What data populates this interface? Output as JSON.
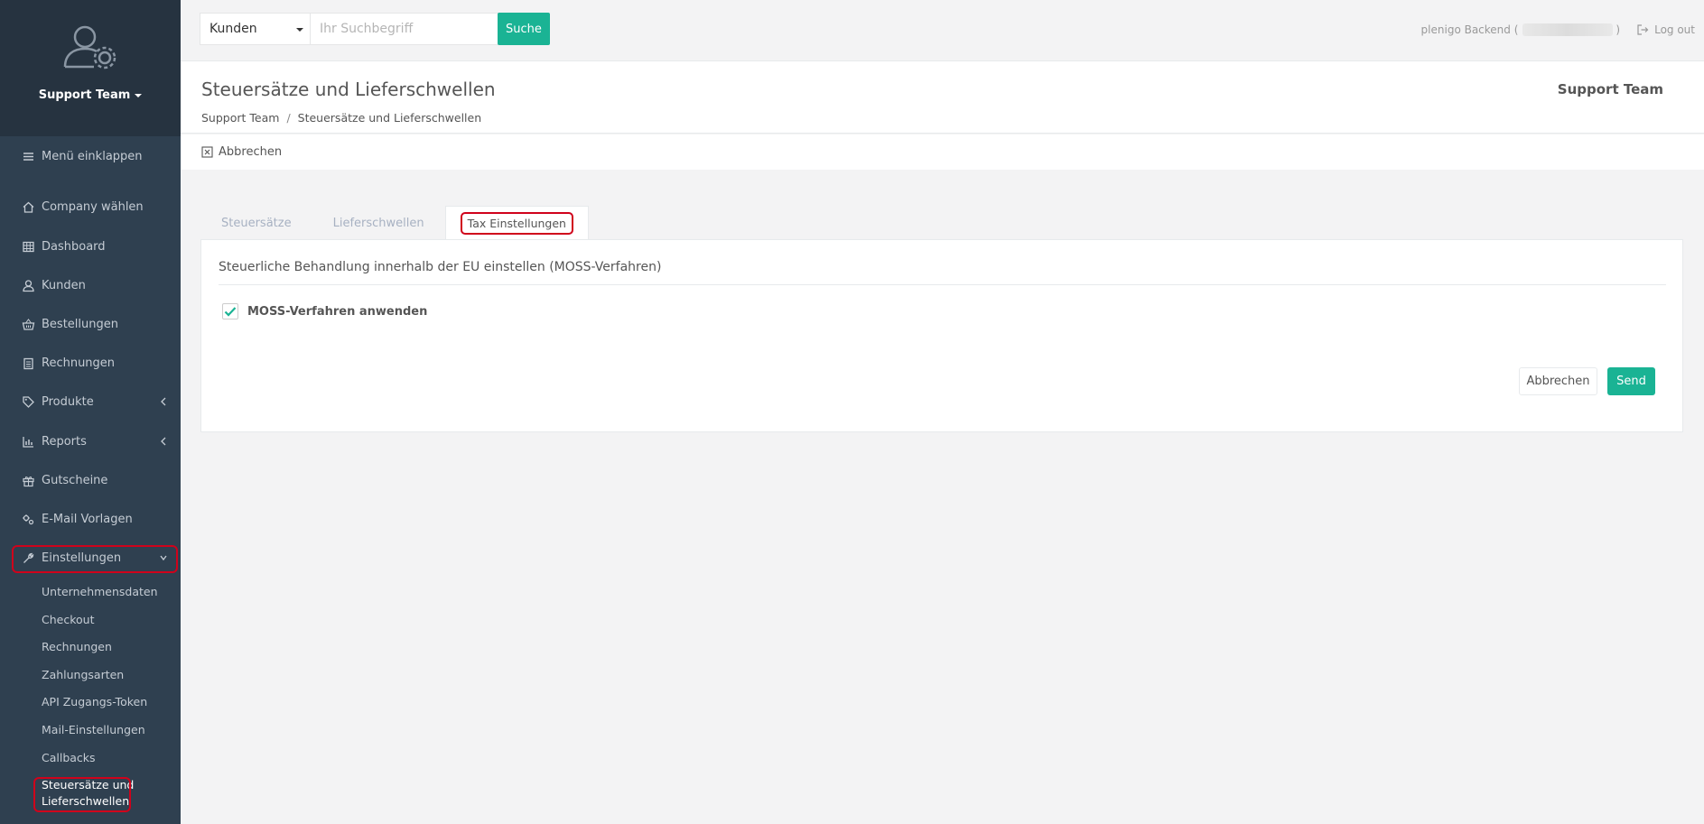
{
  "sidebar": {
    "profile_name": "Support Team",
    "collapse_label": "Menü einklappen",
    "items": [
      {
        "label": "Company wählen",
        "icon": "home-icon"
      },
      {
        "label": "Dashboard",
        "icon": "table-icon"
      },
      {
        "label": "Kunden",
        "icon": "user-icon"
      },
      {
        "label": "Bestellungen",
        "icon": "basket-icon"
      },
      {
        "label": "Rechnungen",
        "icon": "clipboard-icon"
      },
      {
        "label": "Produkte",
        "icon": "tag-icon"
      },
      {
        "label": "Reports",
        "icon": "bar-chart-icon"
      },
      {
        "label": "Gutscheine",
        "icon": "gift-icon"
      },
      {
        "label": "E-Mail Vorlagen",
        "icon": "cogs-icon"
      },
      {
        "label": "Einstellungen",
        "icon": "wrench-icon"
      }
    ],
    "subitems": [
      "Unternehmensdaten",
      "Checkout",
      "Rechnungen",
      "Zahlungsarten",
      "API Zugangs-Token",
      "Mail-Einstellungen",
      "Callbacks"
    ],
    "active_subitem_line1": "Steuersätze und",
    "active_subitem_line2": "Lieferschwellen"
  },
  "topbar": {
    "search_select_value": "Kunden",
    "search_placeholder": "Ihr Suchbegriff",
    "search_button": "Suche",
    "backend_label": "plenigo Backend (",
    "backend_close": ")",
    "logout_label": "Log out"
  },
  "heading": {
    "title": "Steuersätze und Lieferschwellen",
    "breadcrumb_root": "Support Team",
    "breadcrumb_sep": "/",
    "breadcrumb_current": "Steuersätze und Lieferschwellen",
    "right_label": "Support Team"
  },
  "toolbar": {
    "cancel_label": "Abbrechen"
  },
  "tabs": [
    {
      "label": "Steuersätze"
    },
    {
      "label": "Lieferschwellen"
    },
    {
      "label": "Tax Einstellungen"
    }
  ],
  "panel": {
    "title": "Steuerliche Behandlung innerhalb der EU einstellen (MOSS-Verfahren)",
    "checkbox_label": "MOSS-Verfahren anwenden",
    "cancel_button": "Abbrechen",
    "send_button": "Send"
  },
  "colors": {
    "sidebar_bg": "#2f4050",
    "primary": "#1ab394",
    "highlight": "#d0021b"
  }
}
